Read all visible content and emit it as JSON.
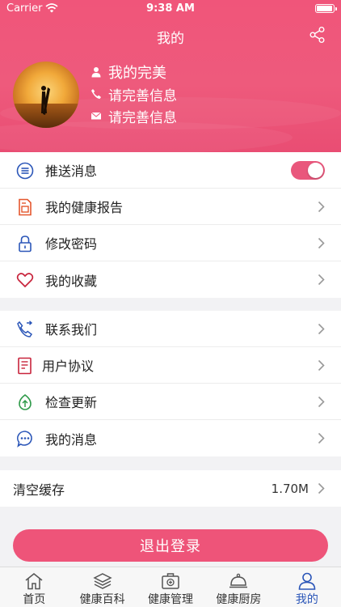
{
  "status_bar": {
    "carrier": "Carrier",
    "time": "9:38 AM"
  },
  "header": {
    "title": "我的",
    "username": "我的完美",
    "phone": "请完善信息",
    "email": "请完善信息"
  },
  "colors": {
    "accent": "#ee5479",
    "tab_active": "#2b56b8"
  },
  "section1": [
    {
      "label": "推送消息",
      "icon": "message-list-icon",
      "toggle_on": true
    },
    {
      "label": "我的健康报告",
      "icon": "report-icon"
    },
    {
      "label": "修改密码",
      "icon": "lock-icon"
    },
    {
      "label": "我的收藏",
      "icon": "heart-icon"
    }
  ],
  "section2": [
    {
      "label": "联系我们",
      "icon": "phone-call-icon"
    },
    {
      "label": "用户协议",
      "icon": "document-icon"
    },
    {
      "label": "检查更新",
      "icon": "update-icon"
    },
    {
      "label": "我的消息",
      "icon": "chat-bubble-icon"
    }
  ],
  "cache": {
    "label": "清空缓存",
    "value": "1.70M"
  },
  "logout_label": "退出登录",
  "tabs": [
    {
      "label": "首页",
      "icon": "home-icon",
      "active": false
    },
    {
      "label": "健康百科",
      "icon": "layers-icon",
      "active": false
    },
    {
      "label": "健康管理",
      "icon": "medical-kit-icon",
      "active": false
    },
    {
      "label": "健康厨房",
      "icon": "cloche-icon",
      "active": false
    },
    {
      "label": "我的",
      "icon": "person-icon",
      "active": true
    }
  ]
}
